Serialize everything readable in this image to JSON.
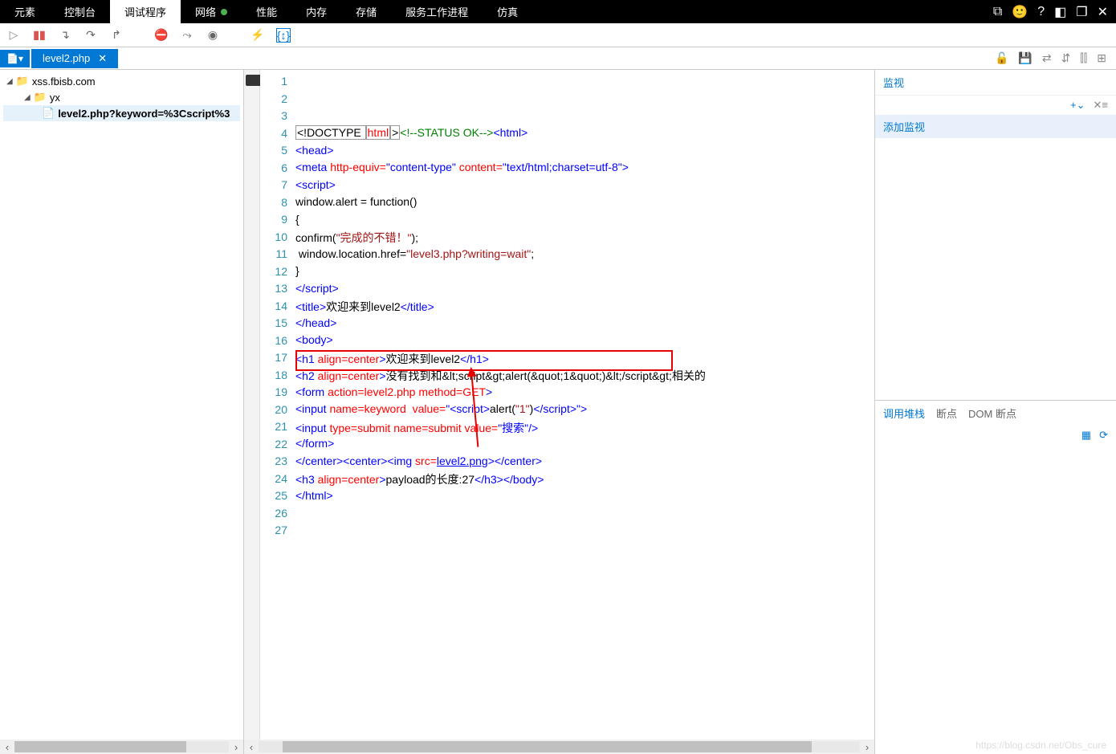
{
  "topTabs": {
    "items": [
      "元素",
      "控制台",
      "调试程序",
      "网络",
      "性能",
      "内存",
      "存储",
      "服务工作进程",
      "仿真"
    ],
    "activeIndex": 2,
    "networkSuffixDot": true
  },
  "topRight": {
    "emoji": "🙂"
  },
  "fileTab": {
    "name": "level2.php"
  },
  "tree": {
    "root": "xss.fbisb.com",
    "folder": "yx",
    "file": "level2.php?keyword=%3Cscript%3"
  },
  "code": {
    "lines": [
      {
        "n": 1,
        "segs": [
          {
            "c": "doctype-box",
            "t": "<!DOCTYPE "
          },
          {
            "c": "t-attr doctype-box",
            "t": "html"
          },
          {
            "c": "doctype-box",
            "t": ">"
          },
          {
            "c": "t-com",
            "t": "<!--STATUS OK-->"
          },
          {
            "c": "t-tag",
            "t": "<html>"
          }
        ]
      },
      {
        "n": 2,
        "segs": [
          {
            "c": "t-tag",
            "t": "<head>"
          }
        ]
      },
      {
        "n": 3,
        "segs": [
          {
            "c": "t-tag",
            "t": "<meta "
          },
          {
            "c": "t-attr",
            "t": "http-equiv="
          },
          {
            "c": "t-val",
            "t": "\"content-type\""
          },
          {
            "c": "t-tag",
            "t": " "
          },
          {
            "c": "t-attr",
            "t": "content="
          },
          {
            "c": "t-val",
            "t": "\"text/html;charset=utf-8\""
          },
          {
            "c": "t-tag",
            "t": ">"
          }
        ]
      },
      {
        "n": 4,
        "segs": [
          {
            "c": "t-tag",
            "t": "<script>"
          }
        ]
      },
      {
        "n": 5,
        "segs": [
          {
            "c": "t-txt",
            "t": "window.alert = function()"
          }
        ]
      },
      {
        "n": 6,
        "segs": [
          {
            "c": "t-txt",
            "t": "{"
          }
        ]
      },
      {
        "n": 7,
        "segs": [
          {
            "c": "t-txt",
            "t": "confirm("
          },
          {
            "c": "t-str",
            "t": "\"完成的不错！\""
          },
          {
            "c": "t-txt",
            "t": ");"
          }
        ]
      },
      {
        "n": 8,
        "segs": [
          {
            "c": "t-txt",
            "t": " window.location.href="
          },
          {
            "c": "t-str",
            "t": "\"level3.php?writing=wait\""
          },
          {
            "c": "t-txt",
            "t": ";"
          }
        ]
      },
      {
        "n": 9,
        "segs": [
          {
            "c": "t-txt",
            "t": "}"
          }
        ]
      },
      {
        "n": 10,
        "segs": [
          {
            "c": "t-tag",
            "t": "</script>"
          }
        ]
      },
      {
        "n": 11,
        "segs": [
          {
            "c": "t-tag",
            "t": "<title>"
          },
          {
            "c": "t-txt",
            "t": "欢迎来到level2"
          },
          {
            "c": "t-tag",
            "t": "</title>"
          }
        ]
      },
      {
        "n": 12,
        "segs": [
          {
            "c": "t-tag",
            "t": "</head>"
          }
        ]
      },
      {
        "n": 13,
        "segs": [
          {
            "c": "t-tag",
            "t": "<body>"
          }
        ]
      },
      {
        "n": 14,
        "segs": [
          {
            "c": "t-tag",
            "t": "<h1 "
          },
          {
            "c": "t-attr",
            "t": "align="
          },
          {
            "c": "t-attr",
            "t": "center"
          },
          {
            "c": "t-tag",
            "t": ">"
          },
          {
            "c": "t-txt",
            "t": "欢迎来到level2"
          },
          {
            "c": "t-tag",
            "t": "</h1>"
          }
        ]
      },
      {
        "n": 15,
        "segs": [
          {
            "c": "t-tag",
            "t": "<h2 "
          },
          {
            "c": "t-attr",
            "t": "align="
          },
          {
            "c": "t-attr",
            "t": "center"
          },
          {
            "c": "t-tag",
            "t": ">"
          },
          {
            "c": "t-txt",
            "t": "没有找到和&lt;script&gt;alert(&quot;1&quot;)&lt;/script&gt;相关的"
          }
        ]
      },
      {
        "n": 16,
        "segs": [
          {
            "c": "t-tag",
            "t": "<form "
          },
          {
            "c": "t-attr",
            "t": "action="
          },
          {
            "c": "t-attr",
            "t": "level2.php"
          },
          {
            "c": "t-tag",
            "t": " "
          },
          {
            "c": "t-attr",
            "t": "method="
          },
          {
            "c": "t-attr",
            "t": "GET"
          },
          {
            "c": "t-tag",
            "t": ">"
          }
        ]
      },
      {
        "n": 17,
        "segs": [
          {
            "c": "t-tag",
            "t": "<input "
          },
          {
            "c": "t-attr",
            "t": "name="
          },
          {
            "c": "t-attr",
            "t": "keyword"
          },
          {
            "c": "t-tag",
            "t": "  "
          },
          {
            "c": "t-attr",
            "t": "value="
          },
          {
            "c": "t-val",
            "t": "\""
          },
          {
            "c": "t-tag",
            "t": "<script>"
          },
          {
            "c": "t-txt",
            "t": "alert("
          },
          {
            "c": "t-str",
            "t": "\"1\""
          },
          {
            "c": "t-txt",
            "t": ")"
          },
          {
            "c": "t-tag",
            "t": "</script>"
          },
          {
            "c": "t-val",
            "t": "\""
          },
          {
            "c": "t-tag",
            "t": ">"
          }
        ]
      },
      {
        "n": 18,
        "segs": [
          {
            "c": "t-tag",
            "t": "<input "
          },
          {
            "c": "t-attr",
            "t": "type="
          },
          {
            "c": "t-attr",
            "t": "submit"
          },
          {
            "c": "t-tag",
            "t": " "
          },
          {
            "c": "t-attr",
            "t": "name="
          },
          {
            "c": "t-attr",
            "t": "submit"
          },
          {
            "c": "t-tag",
            "t": " "
          },
          {
            "c": "t-attr",
            "t": "value="
          },
          {
            "c": "t-val",
            "t": "\"搜索\""
          },
          {
            "c": "t-tag",
            "t": "/>"
          }
        ]
      },
      {
        "n": 19,
        "segs": [
          {
            "c": "t-tag",
            "t": "</form>"
          }
        ]
      },
      {
        "n": 20,
        "segs": [
          {
            "c": "t-tag",
            "t": "</center><center><img "
          },
          {
            "c": "t-attr",
            "t": "src="
          },
          {
            "c": "t-url",
            "t": "level2.png"
          },
          {
            "c": "t-tag",
            "t": "></center>"
          }
        ]
      },
      {
        "n": 21,
        "segs": [
          {
            "c": "t-tag",
            "t": "<h3 "
          },
          {
            "c": "t-attr",
            "t": "align="
          },
          {
            "c": "t-attr",
            "t": "center"
          },
          {
            "c": "t-tag",
            "t": ">"
          },
          {
            "c": "t-txt",
            "t": "payload的长度:27"
          },
          {
            "c": "t-tag",
            "t": "</h3></body>"
          }
        ]
      },
      {
        "n": 22,
        "segs": [
          {
            "c": "t-tag",
            "t": "</html>"
          }
        ]
      },
      {
        "n": 23,
        "segs": []
      },
      {
        "n": 24,
        "segs": []
      },
      {
        "n": 25,
        "segs": []
      },
      {
        "n": 26,
        "segs": []
      },
      {
        "n": 27,
        "segs": []
      }
    ]
  },
  "rightPanel": {
    "watch": {
      "title": "监视",
      "add": "添加监视"
    },
    "stack": {
      "tabs": [
        "调用堆栈",
        "断点",
        "DOM 断点"
      ],
      "activeIndex": 0
    }
  },
  "watermark": "https://blog.csdn.net/Obs_cure"
}
